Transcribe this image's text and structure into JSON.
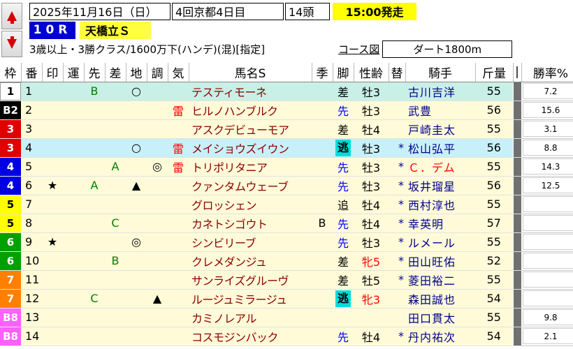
{
  "header": {
    "date": "2025年11月16日（日）",
    "venue": "4回京都4日目",
    "heads": "14頭",
    "post_time": "15:00発走",
    "race_no": "10R",
    "race_name": "天橋立Ｓ",
    "conditions": "3歳以上・3勝クラス/1600万下(ハンデ)(混)[指定]",
    "course_link": "コース図",
    "distance": "ダート1800m"
  },
  "columns": [
    "枠",
    "番",
    "印",
    "運",
    "先",
    "差",
    "地",
    "調",
    "気",
    "馬名S",
    "季",
    "脚",
    "性齢",
    "替",
    "騎手",
    "斤量",
    "|",
    "勝率%"
  ],
  "colors": {
    "waku": {
      "1": {
        "bg": "#ffffff",
        "fg": "#000000"
      },
      "2": {
        "bg": "#000000",
        "fg": "#ffffff"
      },
      "3": {
        "bg": "#e00000",
        "fg": "#ffffff"
      },
      "4": {
        "bg": "#0000e0",
        "fg": "#ffffff"
      },
      "5": {
        "bg": "#ffff00",
        "fg": "#000000"
      },
      "6": {
        "bg": "#00a000",
        "fg": "#ffffff"
      },
      "7": {
        "bg": "#ff8000",
        "fg": "#ffffff"
      },
      "8": {
        "bg": "#ff60ff",
        "fg": "#ffffff"
      }
    },
    "row_teal": "#c8f0e6",
    "row_yellow": "#fffbd8",
    "row_white": "#ffffff",
    "row_light": "#c8f0f8"
  },
  "rows": [
    {
      "waku": "1",
      "wnum": "1",
      "num": "1",
      "mark": "",
      "un": "",
      "saki": "B",
      "sashi": "",
      "chi": "○",
      "cho": "",
      "ki": "",
      "name": "テスティモーネ",
      "season": "",
      "leg": "差",
      "leg_style": "plain",
      "sexage": "牡3",
      "sexage_red": false,
      "kae": "",
      "jockey": "古川吉洋",
      "weight": "55",
      "rate": "7.2",
      "row": "teal"
    },
    {
      "waku": "B2",
      "wnum": "2",
      "num": "2",
      "mark": "",
      "un": "",
      "saki": "",
      "sashi": "",
      "chi": "",
      "cho": "",
      "ki": "雷",
      "name": "ヒルノハンブルク",
      "season": "",
      "leg": "先",
      "leg_style": "blue",
      "sexage": "牡3",
      "sexage_red": false,
      "kae": "",
      "jockey": "武豊",
      "weight": "56",
      "rate": "15.6",
      "row": "yellow"
    },
    {
      "waku": "3",
      "wnum": "3",
      "num": "3",
      "mark": "",
      "un": "",
      "saki": "",
      "sashi": "",
      "chi": "",
      "cho": "",
      "ki": "",
      "name": "アスクデビューモア",
      "season": "",
      "leg": "差",
      "leg_style": "plain",
      "sexage": "牡4",
      "sexage_red": false,
      "kae": "",
      "jockey": "戸崎圭太",
      "weight": "55",
      "rate": "3.1",
      "row": "yellow"
    },
    {
      "waku": "3",
      "wnum": "3",
      "num": "4",
      "mark": "",
      "un": "",
      "saki": "",
      "sashi": "",
      "chi": "○",
      "cho": "",
      "ki": "雷",
      "name": "メイショウズイウン",
      "season": "",
      "leg": "逃",
      "leg_style": "box",
      "sexage": "牡3",
      "sexage_red": false,
      "kae": "*",
      "jockey": "松山弘平",
      "weight": "56",
      "rate": "8.8",
      "row": "light"
    },
    {
      "waku": "4",
      "wnum": "4",
      "num": "5",
      "mark": "",
      "un": "",
      "saki": "",
      "sashi": "A",
      "chi": "",
      "cho": "◎",
      "ki": "雷",
      "name": "トリポリタニア",
      "season": "",
      "leg": "先",
      "leg_style": "blue",
      "sexage": "牡3",
      "sexage_red": false,
      "kae": "*",
      "jockey": "Ｃ．デム",
      "weight": "55",
      "rate": "14.3",
      "row": "yellow",
      "jockey_red": true
    },
    {
      "waku": "4",
      "wnum": "4",
      "num": "6",
      "mark": "★",
      "un": "",
      "saki": "A",
      "sashi": "",
      "chi": "▲",
      "cho": "",
      "ki": "",
      "name": "クァンタムウェーブ",
      "season": "",
      "leg": "先",
      "leg_style": "blue",
      "sexage": "牡3",
      "sexage_red": false,
      "kae": "*",
      "jockey": "坂井瑠星",
      "weight": "56",
      "rate": "12.5",
      "row": "yellow"
    },
    {
      "waku": "5",
      "wnum": "5",
      "num": "7",
      "mark": "",
      "un": "",
      "saki": "",
      "sashi": "",
      "chi": "",
      "cho": "",
      "ki": "",
      "name": "グロッシェン",
      "season": "",
      "leg": "追",
      "leg_style": "plain",
      "sexage": "牡4",
      "sexage_red": false,
      "kae": "*",
      "jockey": "西村淳也",
      "weight": "55",
      "rate": "",
      "row": "yellow"
    },
    {
      "waku": "5",
      "wnum": "5",
      "num": "8",
      "mark": "",
      "un": "",
      "saki": "",
      "sashi": "C",
      "chi": "",
      "cho": "",
      "ki": "",
      "name": "カネトシゴウト",
      "season": "B",
      "leg": "先",
      "leg_style": "blue",
      "sexage": "牡4",
      "sexage_red": false,
      "kae": "*",
      "jockey": "幸英明",
      "weight": "57",
      "rate": "",
      "row": "yellow"
    },
    {
      "waku": "6",
      "wnum": "6",
      "num": "9",
      "mark": "★",
      "un": "",
      "saki": "",
      "sashi": "",
      "chi": "◎",
      "cho": "",
      "ki": "",
      "name": "シンビリーブ",
      "season": "",
      "leg": "先",
      "leg_style": "blue",
      "sexage": "牡3",
      "sexage_red": false,
      "kae": "*",
      "jockey": "ルメール",
      "weight": "55",
      "rate": "",
      "row": "yellow"
    },
    {
      "waku": "6",
      "wnum": "6",
      "num": "10",
      "mark": "",
      "un": "",
      "saki": "",
      "sashi": "B",
      "chi": "",
      "cho": "",
      "ki": "",
      "name": "クレメダンジュ",
      "season": "",
      "leg": "差",
      "leg_style": "plain",
      "sexage": "牝5",
      "sexage_red": true,
      "kae": "*",
      "jockey": "田山旺佑",
      "weight": "52",
      "rate": "",
      "row": "yellow"
    },
    {
      "waku": "7",
      "wnum": "7",
      "num": "11",
      "mark": "",
      "un": "",
      "saki": "",
      "sashi": "",
      "chi": "",
      "cho": "",
      "ki": "",
      "name": "サンライズグルーヴ",
      "season": "",
      "leg": "差",
      "leg_style": "plain",
      "sexage": "牡5",
      "sexage_red": false,
      "kae": "*",
      "jockey": "菱田裕二",
      "weight": "55",
      "rate": "",
      "row": "yellow"
    },
    {
      "waku": "7",
      "wnum": "7",
      "num": "12",
      "mark": "",
      "un": "",
      "saki": "C",
      "sashi": "",
      "chi": "",
      "cho": "▲",
      "ki": "",
      "name": "ルージュミラージュ",
      "season": "",
      "leg": "逃",
      "leg_style": "box",
      "sexage": "牝3",
      "sexage_red": true,
      "kae": "",
      "jockey": "森田誠也",
      "weight": "54",
      "rate": "",
      "row": "yellow"
    },
    {
      "waku": "B8",
      "wnum": "8",
      "num": "13",
      "mark": "",
      "un": "",
      "saki": "",
      "sashi": "",
      "chi": "",
      "cho": "",
      "ki": "",
      "name": "カミノレアル",
      "season": "",
      "leg": "",
      "leg_style": "plain",
      "sexage": "",
      "sexage_red": false,
      "kae": "",
      "jockey": "田口貫太",
      "weight": "55",
      "rate": "9.8",
      "row": "yellow"
    },
    {
      "waku": "B8",
      "wnum": "8",
      "num": "14",
      "mark": "",
      "un": "",
      "saki": "",
      "sashi": "",
      "chi": "",
      "cho": "",
      "ki": "",
      "name": "コスモジンバック",
      "season": "",
      "leg": "先",
      "leg_style": "blue",
      "sexage": "牡4",
      "sexage_red": false,
      "kae": "*",
      "jockey": "丹内祐次",
      "weight": "54",
      "rate": "2.1",
      "row": "yellow"
    }
  ]
}
